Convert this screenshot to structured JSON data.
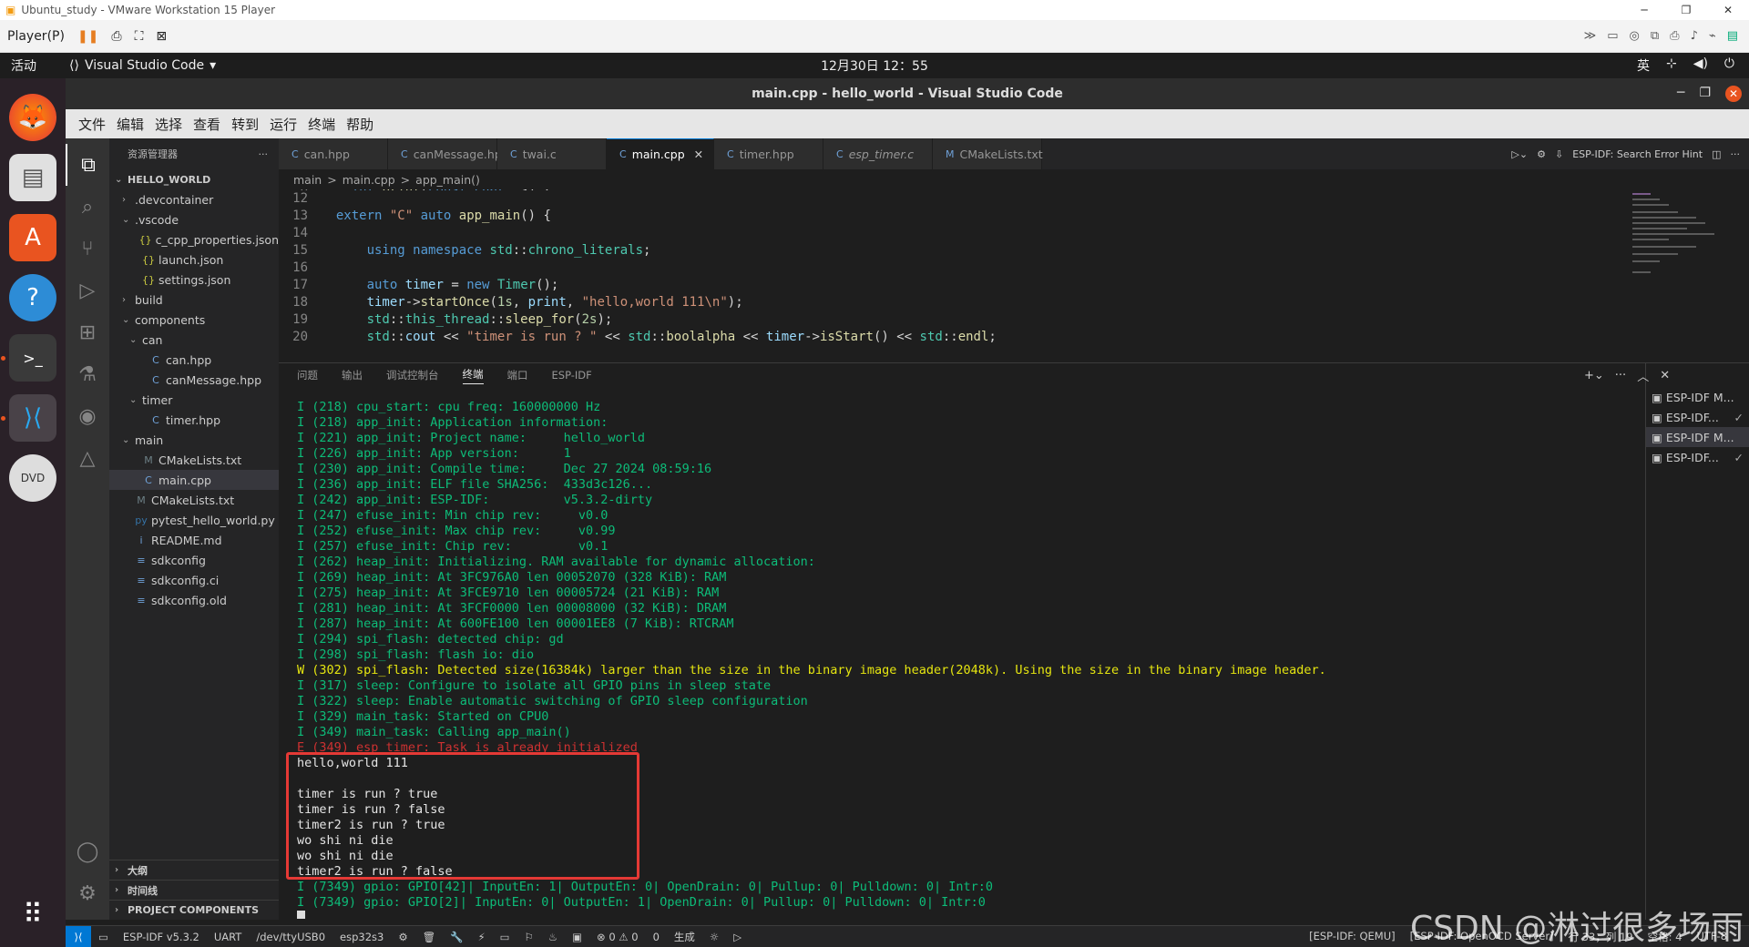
{
  "vmware": {
    "title": "Ubuntu_study - VMware Workstation 15 Player",
    "player_menu": "Player(P)"
  },
  "ubuntu": {
    "activities": "活动",
    "app_name": "Visual Studio Code",
    "clock": "12月30日  12：55",
    "input_method": "英"
  },
  "vscode": {
    "title": "main.cpp - hello_world - Visual Studio Code",
    "menu": [
      "文件",
      "编辑",
      "选择",
      "查看",
      "转到",
      "运行",
      "终端",
      "帮助"
    ],
    "explorer_title": "资源管理器",
    "tree": [
      {
        "label": "HELLO_WORLD",
        "indent": 0,
        "chev": "v",
        "icon": "",
        "bold": true
      },
      {
        "label": ".devcontainer",
        "indent": 1,
        "chev": ">",
        "icon": ""
      },
      {
        "label": ".vscode",
        "indent": 1,
        "chev": "v",
        "icon": ""
      },
      {
        "label": "c_cpp_properties.json",
        "indent": 2,
        "chev": "",
        "icon": "{}"
      },
      {
        "label": "launch.json",
        "indent": 2,
        "chev": "",
        "icon": "{}"
      },
      {
        "label": "settings.json",
        "indent": 2,
        "chev": "",
        "icon": "{}"
      },
      {
        "label": "build",
        "indent": 1,
        "chev": ">",
        "icon": ""
      },
      {
        "label": "components",
        "indent": 1,
        "chev": "v",
        "icon": ""
      },
      {
        "label": "can",
        "indent": 2,
        "chev": "v",
        "icon": ""
      },
      {
        "label": "can.hpp",
        "indent": 3,
        "chev": "",
        "icon": "C"
      },
      {
        "label": "canMessage.hpp",
        "indent": 3,
        "chev": "",
        "icon": "C"
      },
      {
        "label": "timer",
        "indent": 2,
        "chev": "v",
        "icon": ""
      },
      {
        "label": "timer.hpp",
        "indent": 3,
        "chev": "",
        "icon": "C"
      },
      {
        "label": "main",
        "indent": 1,
        "chev": "v",
        "icon": ""
      },
      {
        "label": "CMakeLists.txt",
        "indent": 2,
        "chev": "",
        "icon": "M"
      },
      {
        "label": "main.cpp",
        "indent": 2,
        "chev": "",
        "icon": "C",
        "selected": true
      },
      {
        "label": "CMakeLists.txt",
        "indent": 1,
        "chev": "",
        "icon": "M"
      },
      {
        "label": "pytest_hello_world.py",
        "indent": 1,
        "chev": "",
        "icon": "py"
      },
      {
        "label": "README.md",
        "indent": 1,
        "chev": "",
        "icon": "i"
      },
      {
        "label": "sdkconfig",
        "indent": 1,
        "chev": "",
        "icon": "≡"
      },
      {
        "label": "sdkconfig.ci",
        "indent": 1,
        "chev": "",
        "icon": "≡"
      },
      {
        "label": "sdkconfig.old",
        "indent": 1,
        "chev": "",
        "icon": "≡"
      }
    ],
    "sidebar_bottom": [
      "大纲",
      "时间线",
      "PROJECT COMPONENTS"
    ],
    "tabs": [
      {
        "label": "can.hpp",
        "icon": "C"
      },
      {
        "label": "canMessage.hpp",
        "icon": "C"
      },
      {
        "label": "twai.c",
        "icon": "C"
      },
      {
        "label": "main.cpp",
        "icon": "C",
        "active": true
      },
      {
        "label": "timer.hpp",
        "icon": "C"
      },
      {
        "label": "esp_timer.c",
        "icon": "C"
      },
      {
        "label": "CMakeLists.txt",
        "icon": "M"
      }
    ],
    "tab_hint": "ESP-IDF: Search Error Hint",
    "breadcrumb": [
      "main",
      ">",
      "main.cpp",
      ">",
      "app_main()"
    ],
    "panel_tabs": [
      "问题",
      "输出",
      "调试控制台",
      "终端",
      "端口",
      "ESP-IDF"
    ],
    "terminals": [
      {
        "label": "ESP-IDF M...",
        "check": ""
      },
      {
        "label": "ESP-IDF...",
        "check": "✓"
      },
      {
        "label": "ESP-IDF M...",
        "check": "",
        "active": true
      },
      {
        "label": "ESP-IDF...",
        "check": "✓"
      }
    ],
    "terminal_lines": [
      {
        "t": "I (218) cpu_start: cpu freq: 160000000 Hz",
        "k": "info"
      },
      {
        "t": "I (218) app_init: Application information:",
        "k": "info"
      },
      {
        "t": "I (221) app_init: Project name:     hello_world",
        "k": "info"
      },
      {
        "t": "I (226) app_init: App version:      1",
        "k": "info"
      },
      {
        "t": "I (230) app_init: Compile time:     Dec 27 2024 08:59:16",
        "k": "info"
      },
      {
        "t": "I (236) app_init: ELF file SHA256:  433d3c126...",
        "k": "info"
      },
      {
        "t": "I (242) app_init: ESP-IDF:          v5.3.2-dirty",
        "k": "info"
      },
      {
        "t": "I (247) efuse_init: Min chip rev:     v0.0",
        "k": "info"
      },
      {
        "t": "I (252) efuse_init: Max chip rev:     v0.99",
        "k": "info"
      },
      {
        "t": "I (257) efuse_init: Chip rev:         v0.1",
        "k": "info"
      },
      {
        "t": "I (262) heap_init: Initializing. RAM available for dynamic allocation:",
        "k": "info"
      },
      {
        "t": "I (269) heap_init: At 3FC976A0 len 00052070 (328 KiB): RAM",
        "k": "info"
      },
      {
        "t": "I (275) heap_init: At 3FCE9710 len 00005724 (21 KiB): RAM",
        "k": "info"
      },
      {
        "t": "I (281) heap_init: At 3FCF0000 len 00008000 (32 KiB): DRAM",
        "k": "info"
      },
      {
        "t": "I (287) heap_init: At 600FE100 len 00001EE8 (7 KiB): RTCRAM",
        "k": "info"
      },
      {
        "t": "I (294) spi_flash: detected chip: gd",
        "k": "info"
      },
      {
        "t": "I (298) spi_flash: flash io: dio",
        "k": "info"
      },
      {
        "t": "W (302) spi_flash: Detected size(16384k) larger than the size in the binary image header(2048k). Using the size in the binary image header.",
        "k": "warn"
      },
      {
        "t": "I (317) sleep: Configure to isolate all GPIO pins in sleep state",
        "k": "info"
      },
      {
        "t": "I (322) sleep: Enable automatic switching of GPIO sleep configuration",
        "k": "info"
      },
      {
        "t": "I (329) main_task: Started on CPU0",
        "k": "info"
      },
      {
        "t": "I (349) main_task: Calling app_main()",
        "k": "info"
      },
      {
        "t": "E (349) esp_timer: Task is already initialized",
        "k": "err"
      },
      {
        "t": "hello,world 111",
        "k": "out"
      },
      {
        "t": "",
        "k": "out"
      },
      {
        "t": "timer is run ? true",
        "k": "out"
      },
      {
        "t": "timer is run ? false",
        "k": "out"
      },
      {
        "t": "timer2 is run ? true",
        "k": "out"
      },
      {
        "t": "wo shi ni die",
        "k": "out"
      },
      {
        "t": "wo shi ni die",
        "k": "out"
      },
      {
        "t": "timer2 is run ? false",
        "k": "out"
      },
      {
        "t": "I (7349) gpio: GPIO[42]| InputEn: 1| OutputEn: 0| OpenDrain: 0| Pullup: 0| Pulldown: 0| Intr:0",
        "k": "info"
      },
      {
        "t": "I (7349) gpio: GPIO[2]| InputEn: 0| OutputEn: 1| OpenDrain: 0| Pullup: 0| Pulldown: 0| Intr:0",
        "k": "info"
      }
    ],
    "status": {
      "esp_idf_version": "ESP-IDF v5.3.2",
      "uart": "UART",
      "port": "/dev/ttyUSB0",
      "target": "esp32s3",
      "problems": "⊗ 0 ⚠ 0",
      "ports": "0",
      "build": "生成",
      "qemu": "[ESP-IDF: QEMU]",
      "openocd": "[ESP-IDF: OpenOCD Server]",
      "cursor_pos": "行 33，列 19",
      "spaces": "空格: 4",
      "encoding": "UTF-8"
    }
  },
  "watermark": "CSDN @淋过很多场雨"
}
